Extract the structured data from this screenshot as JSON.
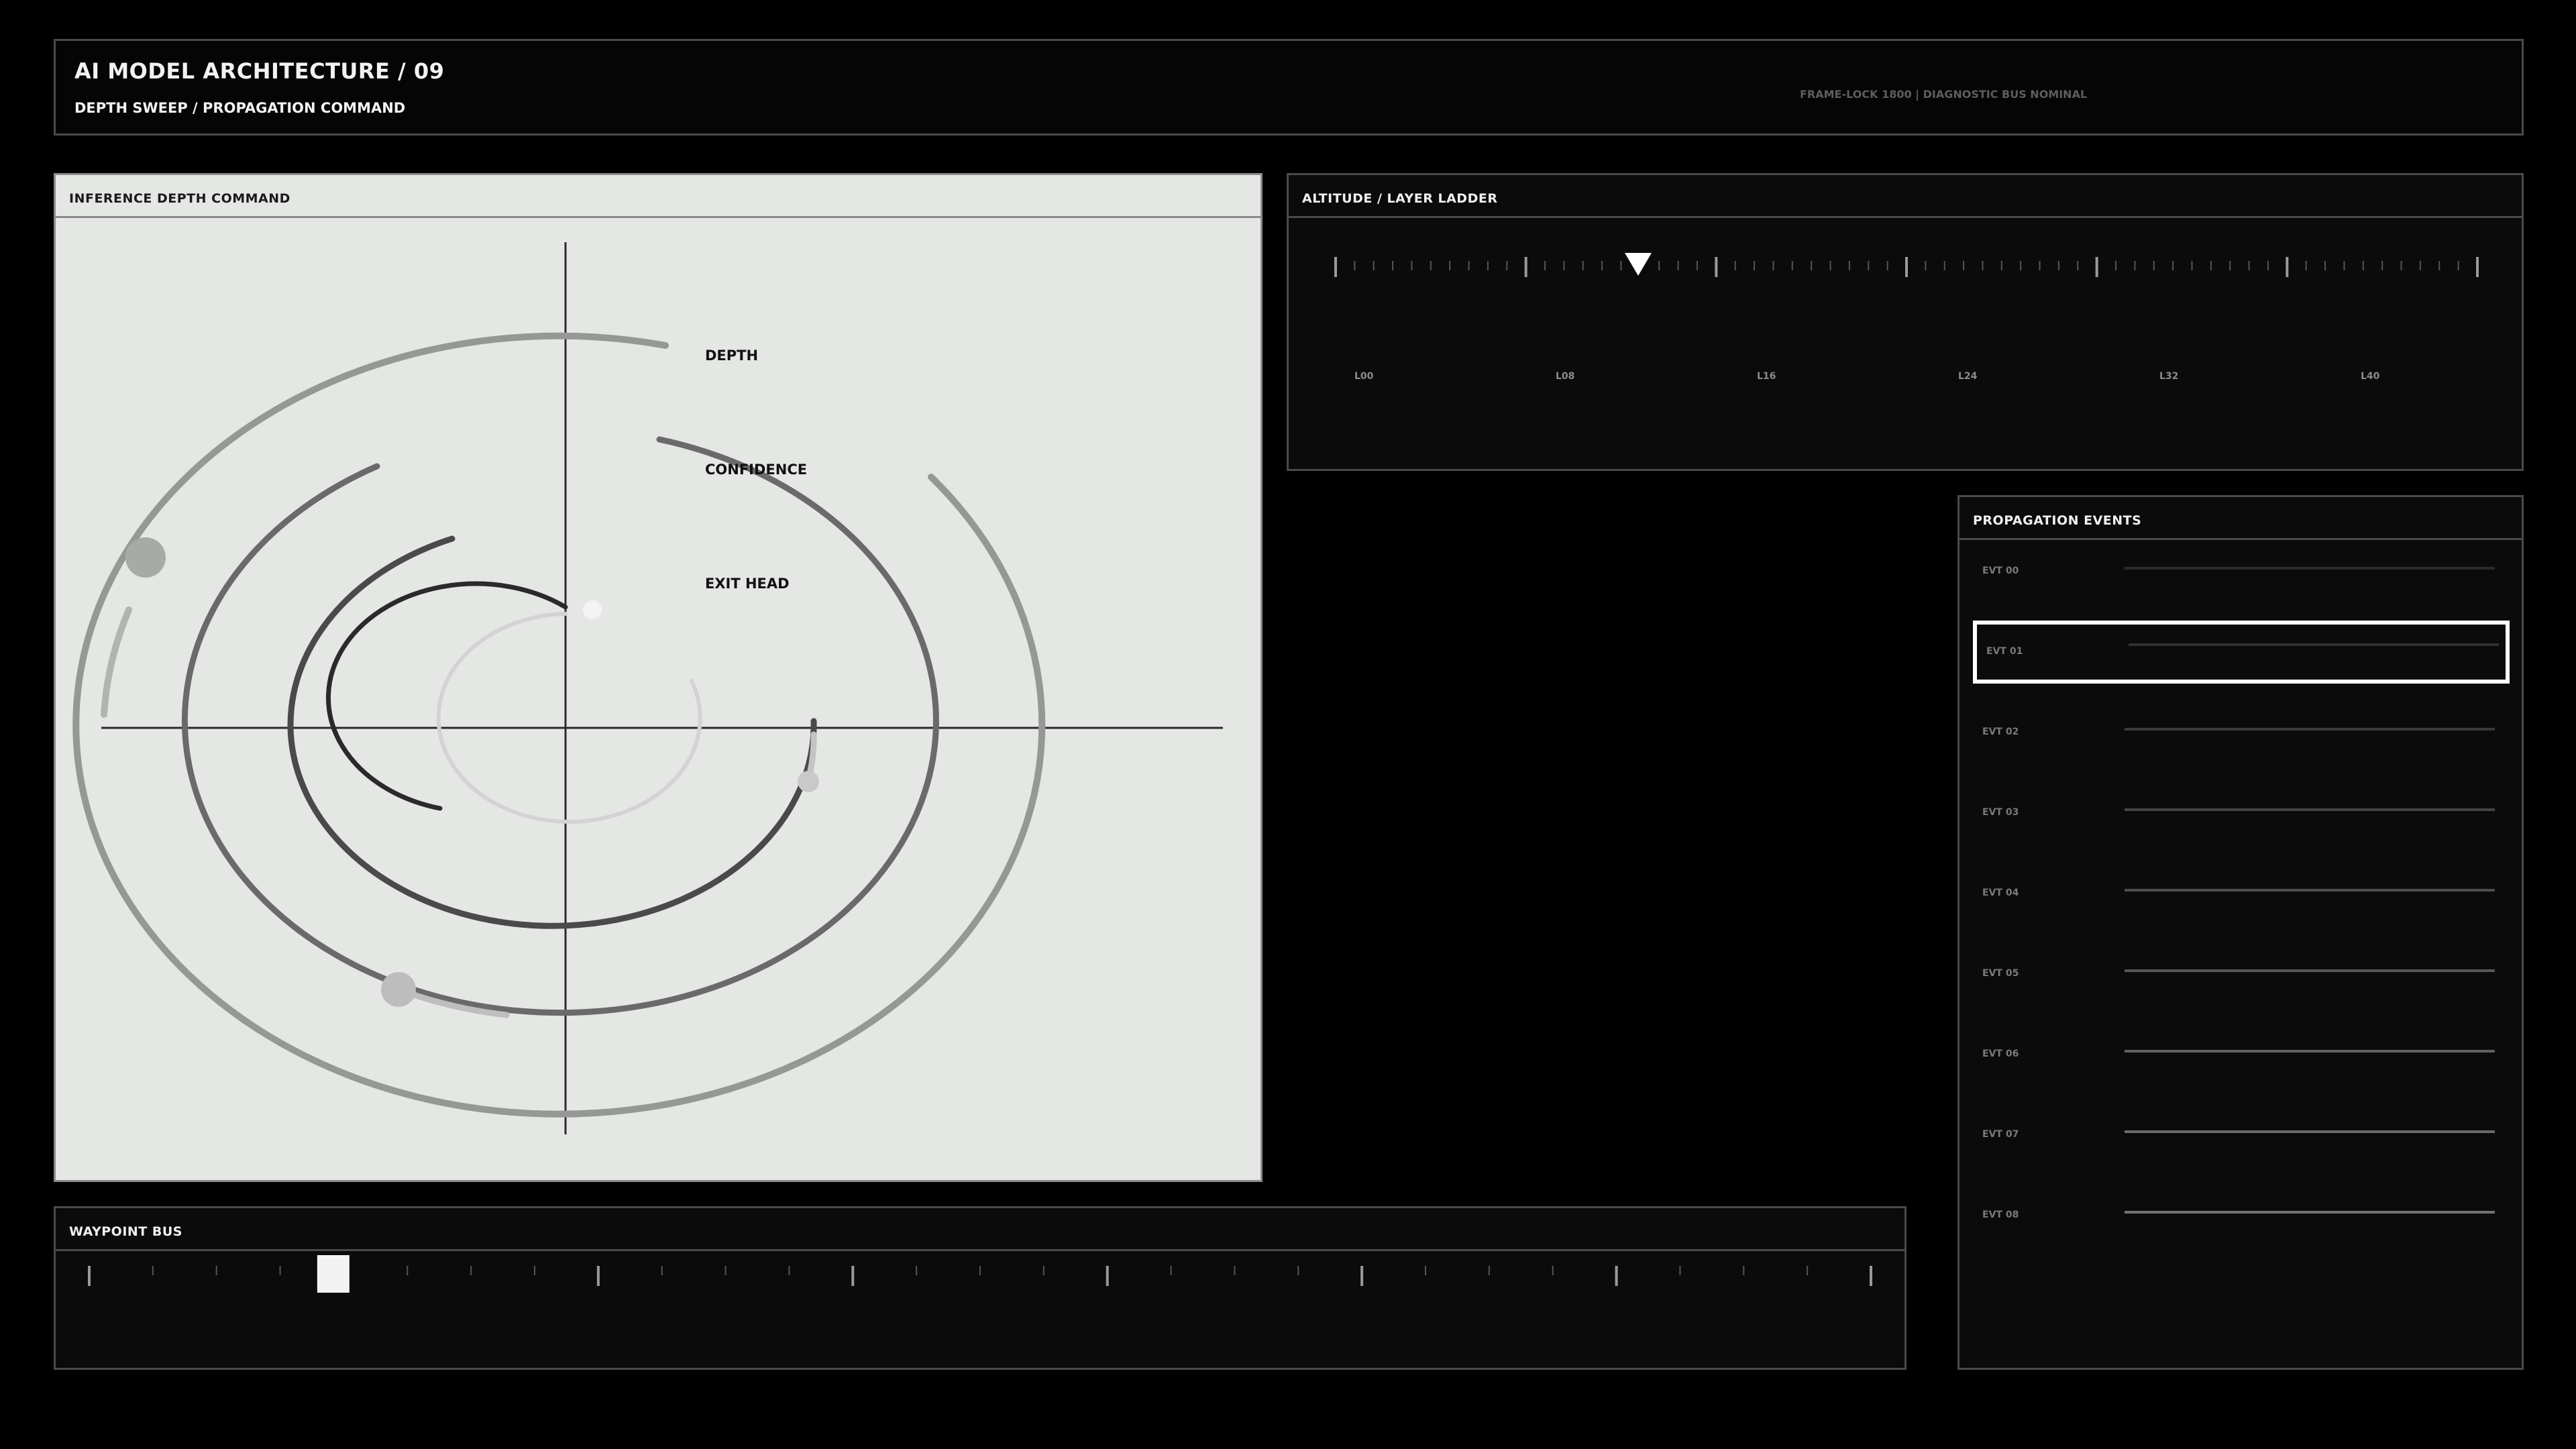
{
  "header": {
    "title": "AI MODEL ARCHITECTURE / 09",
    "subtitle": "DEPTH SWEEP / PROPAGATION COMMAND",
    "status": "FRAME-LOCK 1800 | DIAGNOSTIC BUS NOMINAL"
  },
  "inference": {
    "title": "INFERENCE DEPTH COMMAND",
    "labels": {
      "depth": "DEPTH",
      "confidence": "CONFIDENCE",
      "exit_head": "EXIT HEAD"
    }
  },
  "ladder": {
    "title": "ALTITUDE / LAYER LADDER",
    "labels": [
      "L00",
      "L08",
      "L16",
      "L24",
      "L32",
      "L40"
    ],
    "marker_fraction": 0.265
  },
  "events": {
    "title": "PROPAGATION EVENTS",
    "items": [
      "EVT 00",
      "EVT 01",
      "EVT 02",
      "EVT 03",
      "EVT 04",
      "EVT 05",
      "EVT 06",
      "EVT 07",
      "EVT 08"
    ],
    "selected_index": 1
  },
  "waypoint": {
    "title": "WAYPOINT BUS",
    "marker_fraction": 0.137
  },
  "colors": {
    "background": "#000000",
    "panel": "#0a0b0a",
    "light_panel": "#e5e7e5",
    "border": "#4a4a4a",
    "accent": "#ffffff"
  }
}
